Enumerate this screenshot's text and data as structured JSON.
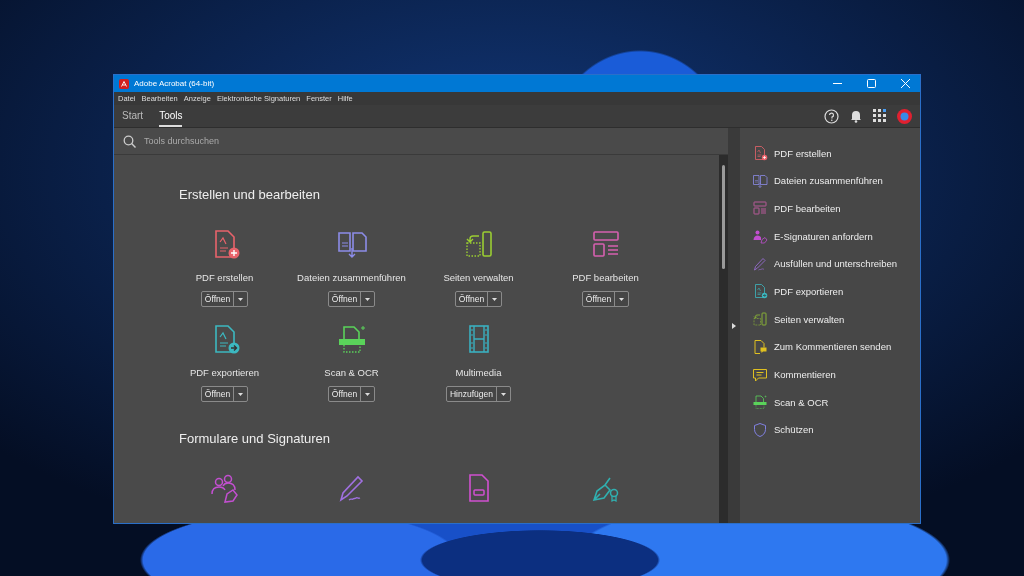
{
  "window": {
    "title": "Adobe Acrobat (64-bit)"
  },
  "menu": [
    "Datei",
    "Bearbeiten",
    "Anzeige",
    "Elektronische Signaturen",
    "Fenster",
    "Hilfe"
  ],
  "tabs": [
    {
      "label": "Start",
      "selected": false
    },
    {
      "label": "Tools",
      "selected": true
    }
  ],
  "search": {
    "placeholder": "Tools durchsuchen"
  },
  "sections": [
    {
      "title": "Erstellen und bearbeiten",
      "tools": [
        {
          "label": "PDF erstellen",
          "button": "Öffnen"
        },
        {
          "label": "Dateien zusammenführen",
          "button": "Öffnen"
        },
        {
          "label": "Seiten verwalten",
          "button": "Öffnen"
        },
        {
          "label": "PDF bearbeiten",
          "button": "Öffnen"
        },
        {
          "label": "PDF exportieren",
          "button": "Öffnen"
        },
        {
          "label": "Scan & OCR",
          "button": "Öffnen"
        },
        {
          "label": "Multimedia",
          "button": "Hinzufügen"
        }
      ]
    },
    {
      "title": "Formulare und Signaturen"
    }
  ],
  "sidebar": {
    "items": [
      "PDF erstellen",
      "Dateien zusammenführen",
      "PDF bearbeiten",
      "E-Signaturen anfordern",
      "Ausfüllen und unterschreiben",
      "PDF exportieren",
      "Seiten verwalten",
      "Zum Kommentieren senden",
      "Kommentieren",
      "Scan & OCR",
      "Schützen"
    ]
  }
}
